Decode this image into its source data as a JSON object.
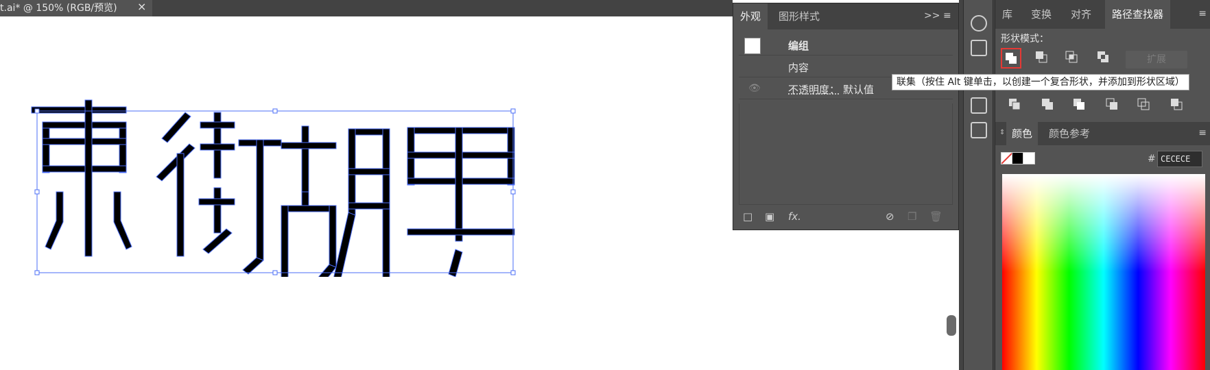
{
  "document_tab": {
    "label": "t.ai* @ 150% (RGB/预览)",
    "close": "×"
  },
  "appearance_panel": {
    "tabs": [
      "外观",
      "图形样式"
    ],
    "collapse": ">>",
    "menu": "≡",
    "rows": {
      "group": "编组",
      "contents": "内容",
      "opacity_label": "不透明度：",
      "opacity_value": "默认值"
    },
    "fx": "fx."
  },
  "pathfinder_panel": {
    "tabs": [
      "库",
      "变换",
      "对齐",
      "路径查找器"
    ],
    "menu": "≡",
    "shape_modes_label": "形状模式：",
    "expand_label": "扩展"
  },
  "tooltip": {
    "text": "联集（按住 Alt 键单击，以创建一个复合形状，并添加到形状区域）"
  },
  "color_panel": {
    "tabs": [
      "颜色",
      "颜色参考"
    ],
    "menu": "≡",
    "hash": "#",
    "hex_value": "CECECE"
  },
  "colors": {
    "panel_bg": "#535353",
    "tab_bar_bg": "#424242",
    "highlight": "#e53935",
    "selection": "#4a6cf7"
  }
}
